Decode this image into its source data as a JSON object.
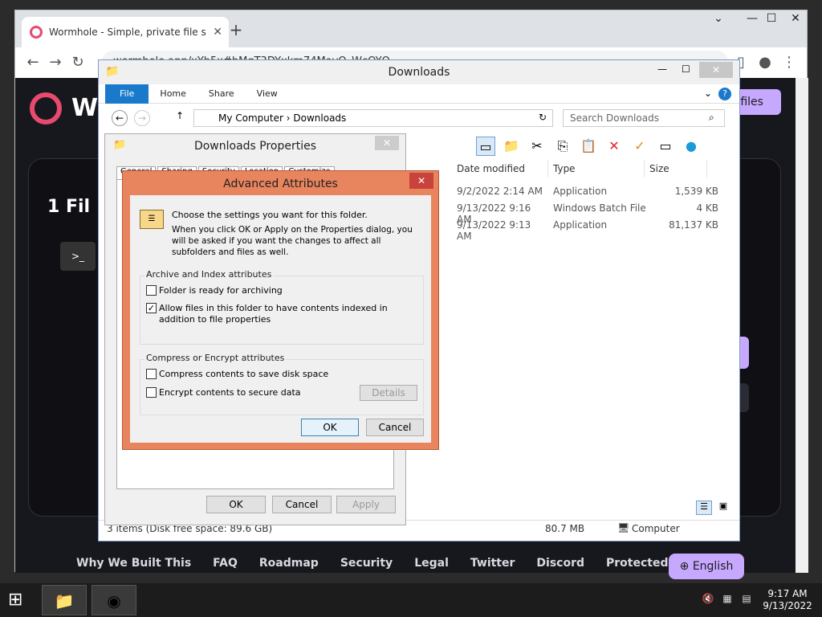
{
  "browser": {
    "tab_title": "Wormhole - Simple, private file s",
    "url": "wormhole.app/xYb5x#bMqT3DYxkm74MayQ_WcOYQ",
    "new_tab": "+",
    "tab_close": "✕"
  },
  "wormhole": {
    "brand": "Wo",
    "send_button": "d files",
    "card_title": "1 Fil",
    "footer": [
      "Why We Built This",
      "FAQ",
      "Roadmap",
      "Security",
      "Legal",
      "Twitter",
      "Discord",
      "Protected by Socket"
    ],
    "language": "English"
  },
  "explorer": {
    "title": "Downloads",
    "ribbon_tabs": [
      "File",
      "Home",
      "Share",
      "View"
    ],
    "breadcrumb": [
      "My Computer",
      "Downloads"
    ],
    "search_placeholder": "Search Downloads",
    "columns": [
      "Date modified",
      "Type",
      "Size"
    ],
    "rows": [
      {
        "date": "9/2/2022 2:14 AM",
        "type": "Application",
        "size": "1,539 KB"
      },
      {
        "date": "9/13/2022 9:16 AM",
        "type": "Windows Batch File",
        "size": "4 KB"
      },
      {
        "date": "9/13/2022 9:13 AM",
        "type": "Application",
        "size": "81,137 KB"
      }
    ],
    "status_items": "3 items (Disk free space: 89.6 GB)",
    "status_size": "80.7 MB",
    "status_location": "Computer"
  },
  "properties": {
    "title": "Downloads Properties",
    "tabs": [
      "General",
      "Sharing",
      "Security",
      "Location",
      "Customize"
    ],
    "ok": "OK",
    "cancel": "Cancel",
    "apply": "Apply"
  },
  "advanced": {
    "title": "Advanced Attributes",
    "intro": "Choose the settings you want for this folder.",
    "intro2": "When you click OK or Apply on the Properties dialog, you will be asked if you want the changes to affect all subfolders and files as well.",
    "group1_label": "Archive and Index attributes",
    "archive_label": "Folder is ready for archiving",
    "archive_checked": false,
    "index_label": "Allow files in this folder to have contents indexed in addition to file properties",
    "index_checked": true,
    "group2_label": "Compress or Encrypt attributes",
    "compress_label": "Compress contents to save disk space",
    "compress_checked": false,
    "encrypt_label": "Encrypt contents to secure data",
    "encrypt_checked": false,
    "details_button": "Details",
    "ok": "OK",
    "cancel": "Cancel"
  },
  "taskbar": {
    "time": "9:17 AM",
    "date": "9/13/2022"
  }
}
